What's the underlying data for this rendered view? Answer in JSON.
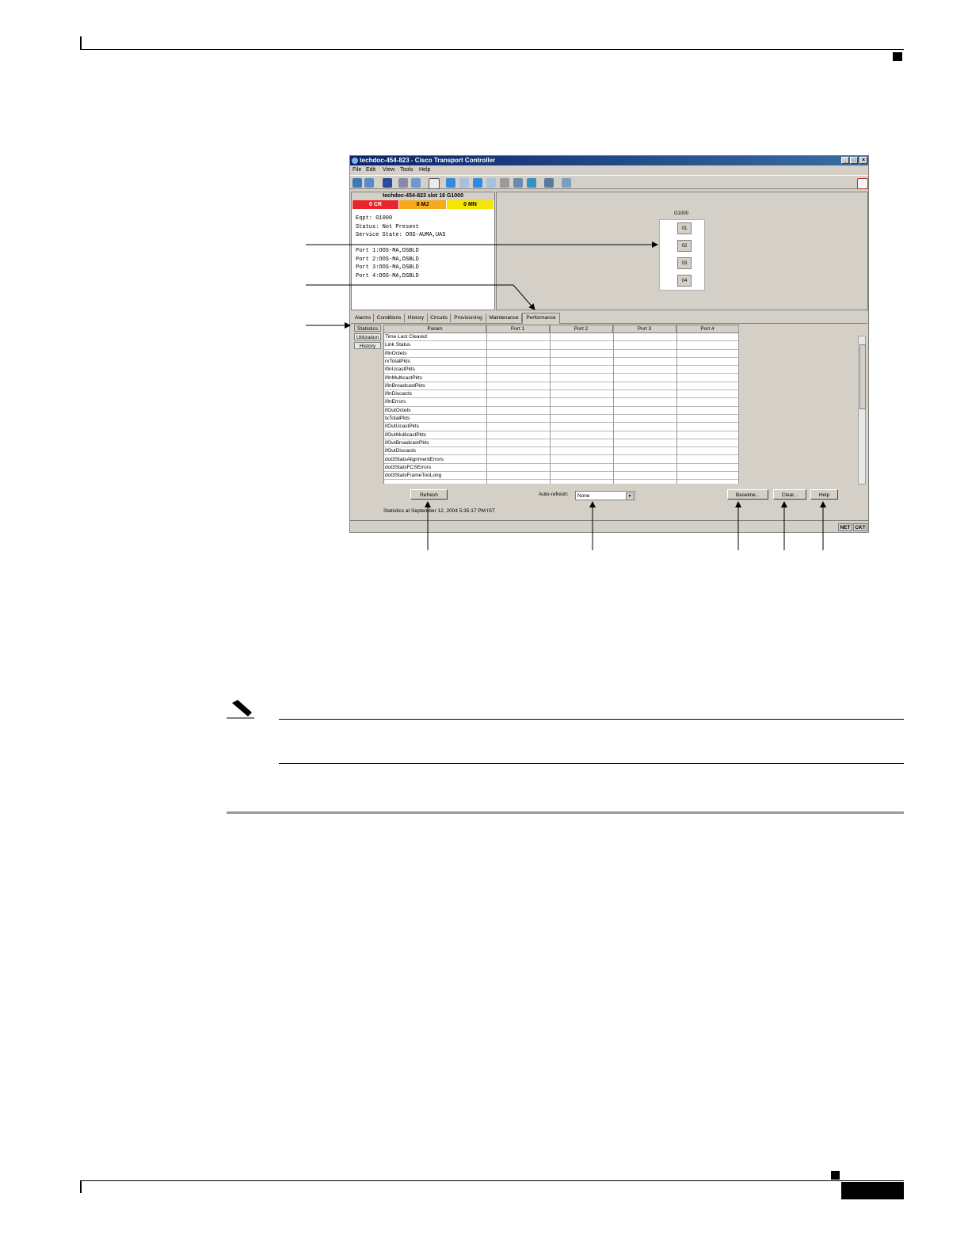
{
  "window": {
    "title": "techdoc-454-823 - Cisco Transport Controller",
    "controls": [
      "_",
      "□",
      "×"
    ]
  },
  "menu": [
    "File",
    "Edit",
    "View",
    "Tools",
    "Help"
  ],
  "card_view": {
    "header": "techdoc-454-823 slot 16 G1000",
    "alarms": {
      "cr": "0 CR",
      "mj": "0 MJ",
      "mn": "0 MN"
    },
    "info": [
      "Eqpt: G1000",
      "Status: Not Present",
      "Service State: OOS-AUMA,UAS"
    ],
    "ports": [
      "Port 1:OOS-MA,DSBLD",
      "Port 2:OOS-MA,DSBLD",
      "Port 3:OOS-MA,DSBLD",
      "Port 4:OOS-MA,DSBLD"
    ],
    "card_label": "G1000",
    "port_buttons": [
      "01",
      "02",
      "03",
      "04"
    ]
  },
  "tabs": [
    "Alarms",
    "Conditions",
    "History",
    "Circuits",
    "Provisioning",
    "Maintenance",
    "Performance"
  ],
  "subtabs": [
    "Statistics",
    "Utilization",
    "History"
  ],
  "table": {
    "headers": [
      "Param",
      "Port 1",
      "Port 2",
      "Port 3",
      "Port 4"
    ],
    "rows": [
      "Time Last Cleared",
      "Link Status",
      "ifInOctets",
      "rxTotalPkts",
      "ifInUcastPkts",
      "ifInMulticastPkts",
      "ifInBroadcastPkts",
      "ifInDiscards",
      "ifInErrors",
      "ifOutOctets",
      "txTotalPkts",
      "ifOutUcastPkts",
      "ifOutMulticastPkts",
      "ifOutBroadcastPkts",
      "ifOutDiscards",
      "dot3StatsAlignmentErrors",
      "dot3StatsFCSErrors",
      "dot3StatsFrameTooLong"
    ]
  },
  "controls": {
    "refresh": "Refresh",
    "auto_refresh_label": "Auto-refresh:",
    "auto_refresh_value": "None",
    "baseline": "Baseline...",
    "clear": "Clear...",
    "help": "Help"
  },
  "status_text": "Statistics at September 12, 2004 5:35:17 PM IST",
  "indicators": [
    "NET",
    "CKT"
  ],
  "colors": {
    "critical": "#e8252a",
    "major": "#f7a81b",
    "minor": "#f5e600"
  }
}
